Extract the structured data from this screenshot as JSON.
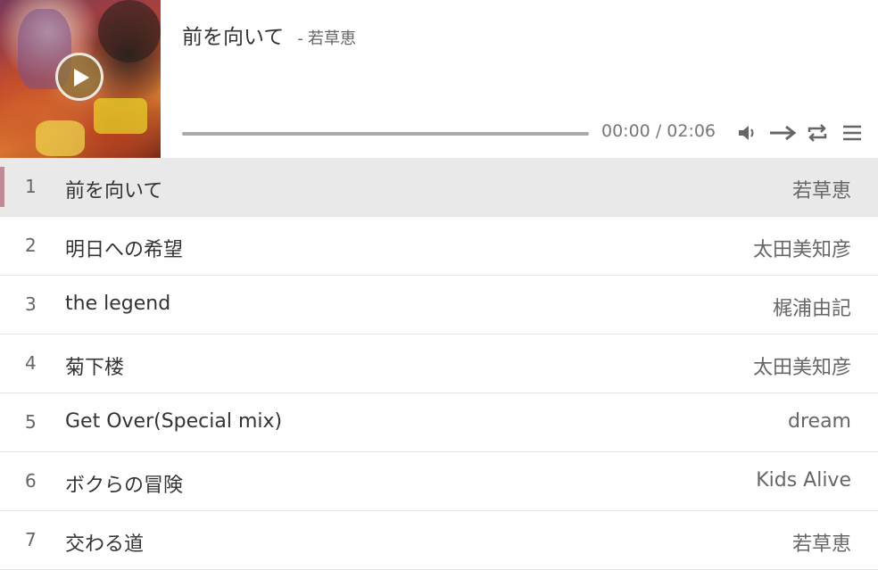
{
  "player": {
    "now_playing": {
      "title": "前を向いて",
      "separator": "-",
      "artist": "若草恵"
    },
    "time": {
      "current": "00:00",
      "separator": "/",
      "total": "02:06",
      "progress": 0
    },
    "controls": [
      "play-icon",
      "volume-icon",
      "order-icon",
      "loop-icon",
      "menu-icon"
    ]
  },
  "playlist": {
    "tracks": [
      {
        "num": "1",
        "title": "前を向いて",
        "artist": "若草恵",
        "active": true
      },
      {
        "num": "2",
        "title": "明日への希望",
        "artist": "太田美知彦"
      },
      {
        "num": "3",
        "title": "the legend",
        "artist": "梶浦由記"
      },
      {
        "num": "4",
        "title": "菊下楼",
        "artist": "太田美知彦"
      },
      {
        "num": "5",
        "title": "Get Over(Special mix)",
        "artist": "dream"
      },
      {
        "num": "6",
        "title": "ボクらの冒険",
        "artist": "Kids Alive"
      },
      {
        "num": "7",
        "title": "交わる道",
        "artist": "若草恵"
      }
    ]
  },
  "colors": {
    "active_row": "#e9e9e9",
    "indicator": "#c08a95",
    "progress_track": "#aaaaaa"
  }
}
